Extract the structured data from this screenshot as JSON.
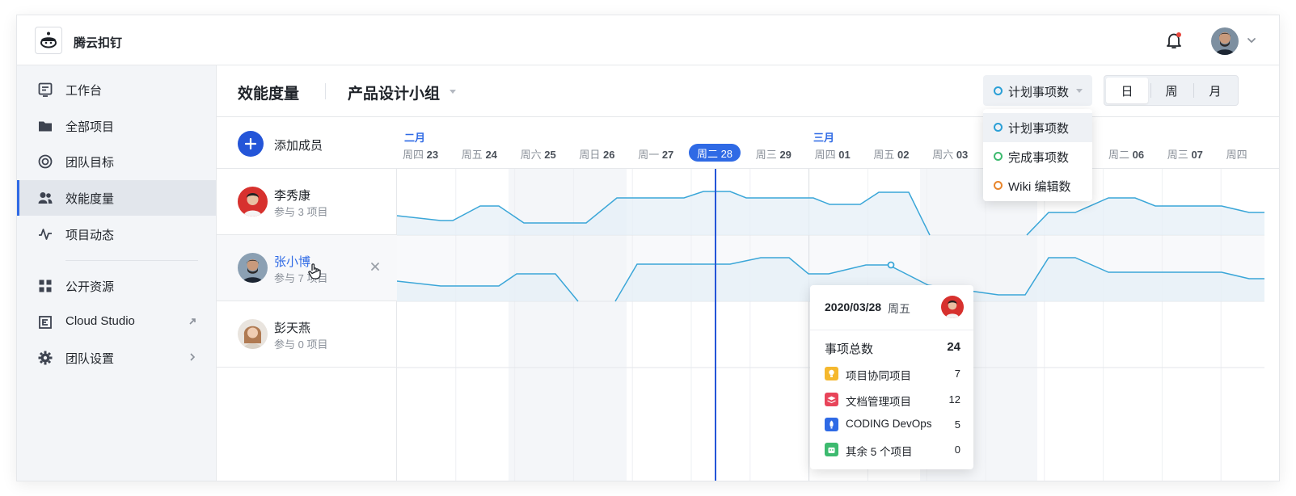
{
  "brand": {
    "name": "腾云扣钉"
  },
  "sidebar": {
    "items": [
      {
        "label": "工作台",
        "icon": "dashboard-icon"
      },
      {
        "label": "全部项目",
        "icon": "folder-icon"
      },
      {
        "label": "团队目标",
        "icon": "target-icon"
      },
      {
        "label": "效能度量",
        "icon": "users-icon",
        "active": true
      },
      {
        "label": "项目动态",
        "icon": "activity-icon"
      },
      {
        "label": "公开资源",
        "icon": "grid-icon"
      },
      {
        "label": "Cloud Studio",
        "icon": "cloud-studio-icon"
      },
      {
        "label": "团队设置",
        "icon": "gear-icon"
      }
    ]
  },
  "header": {
    "title": "效能度量",
    "team": "产品设计小组",
    "metric_selected": "计划事项数",
    "view_modes": [
      "日",
      "周",
      "月"
    ],
    "view_mode_active": "日"
  },
  "metric_dropdown": {
    "options": [
      {
        "label": "计划事项数",
        "color": "#2a9fd6"
      },
      {
        "label": "完成事项数",
        "color": "#3dba6f"
      },
      {
        "label": "Wiki 编辑数",
        "color": "#e8852c"
      }
    ]
  },
  "members_header": {
    "add_label": "添加成员"
  },
  "members": [
    {
      "name": "李秀康",
      "projects": "参与 3 项目"
    },
    {
      "name": "张小博",
      "projects": "参与 7 项目"
    },
    {
      "name": "彭天燕",
      "projects": "参与 0 项目"
    }
  ],
  "timeline": {
    "months": [
      "二月",
      "三月"
    ],
    "days": [
      {
        "wd": "周四",
        "d": "23"
      },
      {
        "wd": "周五",
        "d": "24"
      },
      {
        "wd": "周六",
        "d": "25"
      },
      {
        "wd": "周日",
        "d": "26"
      },
      {
        "wd": "周一",
        "d": "27"
      },
      {
        "wd": "周二",
        "d": "28",
        "today": true
      },
      {
        "wd": "周三",
        "d": "29"
      },
      {
        "wd": "周四",
        "d": "01"
      },
      {
        "wd": "周五",
        "d": "02"
      },
      {
        "wd": "周六",
        "d": "03"
      },
      {
        "wd": "周二",
        "d": "06"
      },
      {
        "wd": "周三",
        "d": "07"
      },
      {
        "wd": "周四",
        "d": ""
      }
    ],
    "today_label": "周二 28"
  },
  "tooltip": {
    "date": "2020/03/28",
    "weekday": "周五",
    "total_label": "事项总数",
    "total_value": "24",
    "rows": [
      {
        "name": "项目协同项目",
        "value": "7",
        "color": "#f5b82e"
      },
      {
        "name": "文档管理项目",
        "value": "12",
        "color": "#e8455a"
      },
      {
        "name": "CODING DevOps",
        "value": "5",
        "color": "#2f6ae5"
      },
      {
        "name": "其余 5 个项目",
        "value": "0",
        "color": "#3dba6f"
      }
    ]
  },
  "colors": {
    "accent": "#2f6ae5",
    "line": "#2a9fd6",
    "sidebar_bg": "#f3f5f8"
  }
}
